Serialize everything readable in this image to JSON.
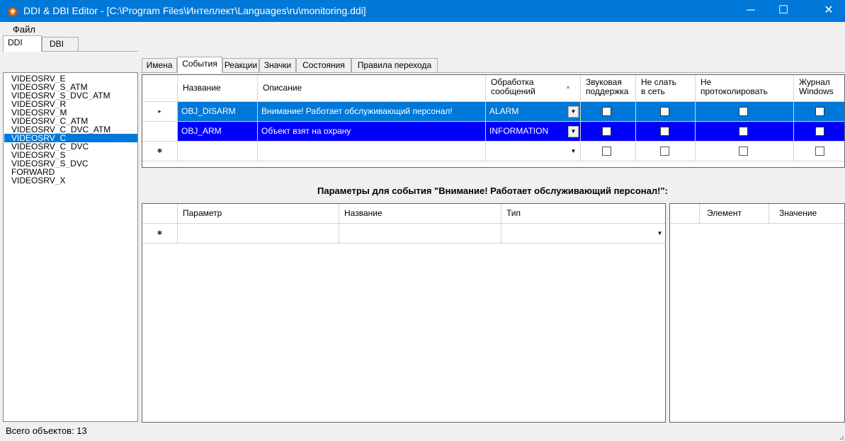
{
  "window": {
    "title": "DDI & DBI Editor - [C:\\Program Files\\Интеллект\\Languages\\ru\\monitoring.ddi]",
    "minimize": "─",
    "maximize": "☐",
    "close": "✕",
    "accent": "#0078d7"
  },
  "menu": {
    "file": "Файл"
  },
  "left_tabs": [
    {
      "label": "DDI",
      "active": true
    },
    {
      "label": "DBI",
      "active": false
    }
  ],
  "objects": [
    {
      "label": "VIDEOSRV_E"
    },
    {
      "label": "VIDEOSRV_S_ATM"
    },
    {
      "label": "VIDEOSRV_S_DVC_ATM"
    },
    {
      "label": "VIDEOSRV_R"
    },
    {
      "label": "VIDEOSRV_M"
    },
    {
      "label": "VIDEOSRV_C_ATM"
    },
    {
      "label": "VIDEOSRV_C_DVC_ATM"
    },
    {
      "label": "VIDEOSRV_C",
      "selected": true
    },
    {
      "label": "VIDEOSRV_C_DVC"
    },
    {
      "label": "VIDEOSRV_S"
    },
    {
      "label": "VIDEOSRV_S_DVC"
    },
    {
      "label": "FORWARD"
    },
    {
      "label": "VIDEOSRV_X"
    }
  ],
  "tabs": [
    {
      "label": "Имена"
    },
    {
      "label": "События",
      "active": true
    },
    {
      "label": "Реакции"
    },
    {
      "label": "Значки"
    },
    {
      "label": "Состояния"
    },
    {
      "label": "Правила перехода"
    }
  ],
  "events_grid": {
    "columns": {
      "name": "Название",
      "description": "Описание",
      "processing_1": "Обработка",
      "processing_2": "сообщений",
      "sound_1": "Звуковая",
      "sound_2": "поддержка",
      "nonet_1": "Не слать",
      "nonet_2": "в сеть",
      "nolog_1": "Не",
      "nolog_2": "протоколировать",
      "winlog_1": "Журнал",
      "winlog_2": "Windows"
    },
    "rows": [
      {
        "name": "OBJ_DISARM",
        "description": "Внимание! Работает обслуживающий персонал!",
        "processing": "ALARM",
        "sound": false,
        "no_net": false,
        "no_log": false,
        "win_log": false
      },
      {
        "name": "OBJ_ARM",
        "description": "Объект взят на охрану",
        "processing": "INFORMATION",
        "sound": false,
        "no_net": false,
        "no_log": false,
        "win_log": false
      }
    ],
    "current_row_marker": "▸",
    "new_row_marker": "✱"
  },
  "params_title": "Параметры для события \"Внимание! Работает обслуживающий персонал!\":",
  "params_grid": {
    "columns": {
      "param": "Параметр",
      "name": "Название",
      "type": "Тип"
    },
    "new_row_marker": "✱"
  },
  "values_grid": {
    "columns": {
      "element": "Элемент",
      "value": "Значение"
    }
  },
  "status": {
    "text": "Всего объектов: 13"
  },
  "icons": {
    "app": "app-icon",
    "dropdown": "chevron-down-icon",
    "sort": "sort-up-icon"
  }
}
